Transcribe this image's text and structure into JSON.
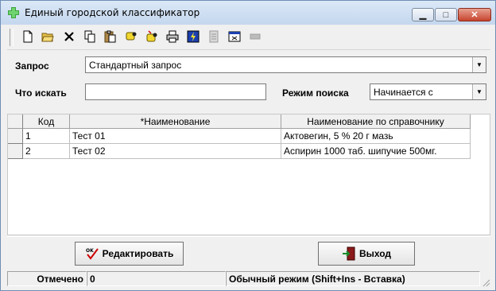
{
  "window": {
    "title": "Единый городской классификатор"
  },
  "titlebar_buttons": {
    "minimize": "▁",
    "maximize": "□",
    "close": "✕"
  },
  "toolbar": {
    "icons": [
      "new-document-icon",
      "open-folder-icon",
      "delete-icon",
      "copy-icon",
      "paste-icon",
      "find-icon",
      "find-next-icon",
      "print-icon",
      "run-icon",
      "disabled-report-icon",
      "window-icon",
      "disabled-bar-icon"
    ]
  },
  "query": {
    "label": "Запрос",
    "value": "Стандартный запрос"
  },
  "search": {
    "label": "Что искать",
    "value": ""
  },
  "mode": {
    "label": "Режим поиска",
    "value": "Начинается с"
  },
  "grid": {
    "columns": [
      "Код",
      "*Наименование",
      "Наименование по справочнику"
    ],
    "rows": [
      {
        "code": "1",
        "name": "Тест 01",
        "ref_name": "Актовегин, 5 % 20 г мазь"
      },
      {
        "code": "2",
        "name": "Тест 02",
        "ref_name": "Аспирин 1000 таб. шипучие 500мг."
      }
    ]
  },
  "buttons": {
    "edit": "Редактировать",
    "exit": "Выход"
  },
  "status": {
    "marked_label": "Отмечено",
    "marked_count": "0",
    "mode_text": "Обычный режим (Shift+Ins - Вставка)"
  },
  "colors": {
    "title_bg": "#c4d7ee",
    "close_btn": "#c7442e",
    "window_bg": "#f0f0f0"
  }
}
